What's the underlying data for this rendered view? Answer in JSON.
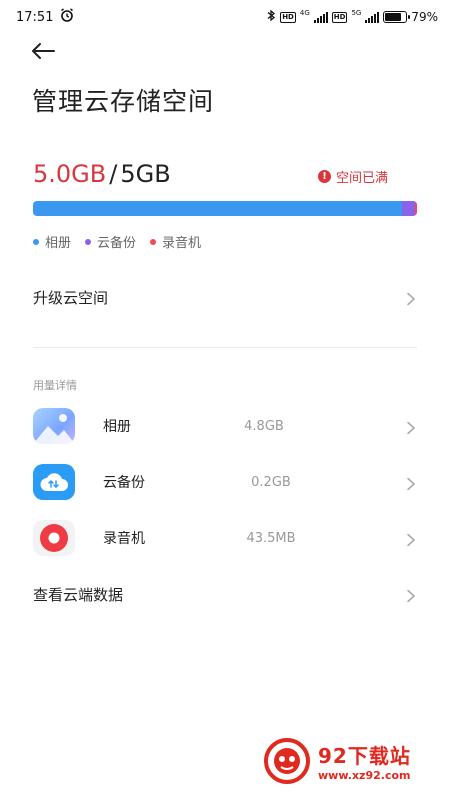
{
  "status_bar": {
    "time": "17:51",
    "battery_text": "79%",
    "battery_level": 0.79,
    "network_1": "4G",
    "network_2": "5G",
    "hd_1": "HD",
    "hd_2": "HD",
    "icons": [
      "alarm-icon",
      "bluetooth-icon",
      "signal-icon",
      "battery-icon"
    ]
  },
  "header": {
    "title": "管理云存储空间"
  },
  "storage": {
    "used": "5.0GB",
    "separator": "/",
    "total": "5GB",
    "full_label": "空间已满",
    "full_icon": "!",
    "segments": [
      {
        "name": "相册",
        "fraction": 0.96,
        "color": "#3b97f0"
      },
      {
        "name": "云备份",
        "fraction": 0.035,
        "color": "#8a63ea"
      },
      {
        "name": "录音机",
        "fraction": 0.005,
        "color": "#ef4c55"
      }
    ]
  },
  "legend": [
    {
      "label": "相册",
      "color": "#3b97f0"
    },
    {
      "label": "云备份",
      "color": "#8a63ea"
    },
    {
      "label": "录音机",
      "color": "#ef4c55"
    }
  ],
  "upgrade": {
    "label": "升级云空间"
  },
  "details": {
    "section_label": "用量详情",
    "items": [
      {
        "name": "相册",
        "size": "4.8GB",
        "icon": "gallery-icon"
      },
      {
        "name": "云备份",
        "size": "0.2GB",
        "icon": "cloud-backup-icon"
      },
      {
        "name": "录音机",
        "size": "43.5MB",
        "icon": "recorder-icon"
      }
    ]
  },
  "view_cloud": {
    "label": "查看云端数据"
  },
  "watermark": {
    "title": "92下载站",
    "url": "www.xz92.com"
  },
  "colors": {
    "accent_red": "#d9363e",
    "text_primary": "#222222",
    "text_secondary": "#999999"
  }
}
